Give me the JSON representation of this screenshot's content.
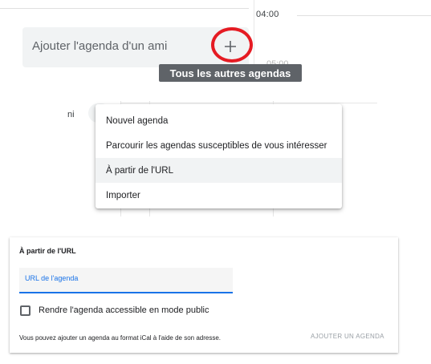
{
  "time": {
    "label": "04:00",
    "faded_label": "05:00"
  },
  "friend": {
    "label": "Ajouter l'agenda d'un ami"
  },
  "tooltip": {
    "text": "Tous les autres agendas"
  },
  "background": {
    "partial_text": "ni"
  },
  "menu": {
    "items": [
      {
        "label": "Nouvel agenda",
        "highlighted": false
      },
      {
        "label": "Parcourir les agendas susceptibles de vous intéresser",
        "highlighted": false
      },
      {
        "label": "À partir de l'URL",
        "highlighted": true
      },
      {
        "label": "Importer",
        "highlighted": false
      }
    ]
  },
  "url_panel": {
    "title": "À partir de l'URL",
    "field_label": "URL de l'agenda",
    "checkbox_label": "Rendre l'agenda accessible en mode public",
    "checkbox_checked": false,
    "help_text": "Vous pouvez ajouter un agenda au format iCal à l'aide de son adresse.",
    "add_button": "AJOUTER UN AGENDA"
  },
  "colors": {
    "accent": "#1a73e8",
    "highlight_circle": "#e51b23",
    "tooltip_bg": "#5f6368",
    "menu_highlight": "#f1f3f4"
  },
  "icons": {
    "add": "plus-icon"
  }
}
